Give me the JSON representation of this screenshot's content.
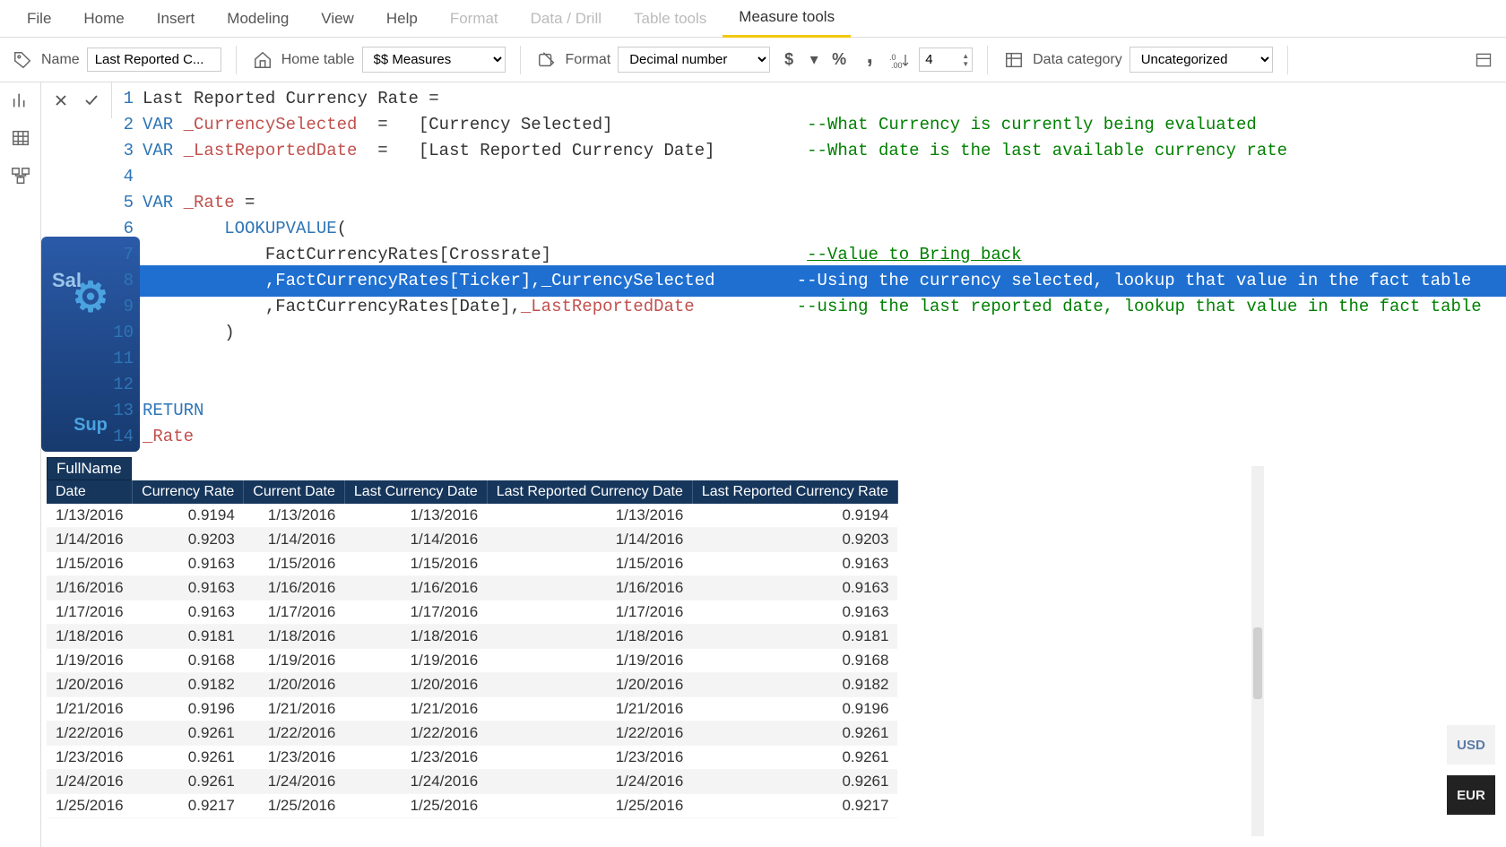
{
  "ribbon": {
    "tabs": [
      "File",
      "Home",
      "Insert",
      "Modeling",
      "View",
      "Help",
      "Format",
      "Data / Drill",
      "Table tools",
      "Measure tools"
    ],
    "active": "Measure tools",
    "dim": [
      "Format",
      "Data / Drill",
      "Table tools"
    ]
  },
  "toolbar": {
    "name_label": "Name",
    "name_value": "Last Reported C...",
    "home_table_label": "Home table",
    "home_table_value": "$$ Measures",
    "format_label": "Format",
    "format_value": "Decimal number",
    "decimals_value": "4",
    "data_category_label": "Data category",
    "data_category_value": "Uncategorized"
  },
  "formula": {
    "lines": [
      {
        "n": 1,
        "segs": [
          {
            "t": "Last Reported Currency Rate ",
            "c": "txt"
          },
          {
            "t": "=",
            "c": "txt"
          }
        ]
      },
      {
        "n": 2,
        "segs": [
          {
            "t": "VAR ",
            "c": "kw"
          },
          {
            "t": "_CurrencySelected",
            "c": "var"
          },
          {
            "t": "  =   ",
            "c": "txt"
          },
          {
            "t": "[Currency Selected]",
            "c": "txt"
          },
          {
            "t": "                   ",
            "c": "txt"
          },
          {
            "t": "--What Currency is currently being evaluated",
            "c": "cmt"
          }
        ]
      },
      {
        "n": 3,
        "segs": [
          {
            "t": "VAR ",
            "c": "kw"
          },
          {
            "t": "_LastReportedDate",
            "c": "var"
          },
          {
            "t": "  =   ",
            "c": "txt"
          },
          {
            "t": "[Last Reported Currency Date]",
            "c": "txt"
          },
          {
            "t": "         ",
            "c": "txt"
          },
          {
            "t": "--What date is the last available currency rate",
            "c": "cmt"
          }
        ]
      },
      {
        "n": 4,
        "segs": [
          {
            "t": "",
            "c": "txt"
          }
        ]
      },
      {
        "n": 5,
        "segs": [
          {
            "t": "VAR ",
            "c": "kw"
          },
          {
            "t": "_Rate",
            "c": "var"
          },
          {
            "t": " =",
            "c": "txt"
          }
        ]
      },
      {
        "n": 6,
        "segs": [
          {
            "t": "        ",
            "c": "txt"
          },
          {
            "t": "LOOKUPVALUE",
            "c": "fn"
          },
          {
            "t": "(",
            "c": "txt"
          }
        ]
      },
      {
        "n": 7,
        "segs": [
          {
            "t": "            FactCurrencyRates[Crossrate]",
            "c": "txt"
          },
          {
            "t": "                         ",
            "c": "txt"
          },
          {
            "t": "--Value to Bring back",
            "c": "cmt hl-under"
          }
        ]
      },
      {
        "n": 8,
        "hl": true,
        "segs": [
          {
            "t": "            ,FactCurrencyRates[Ticker],",
            "c": "txt"
          },
          {
            "t": "_CurrencySelected",
            "c": "var"
          },
          {
            "t": "        ",
            "c": "txt"
          },
          {
            "t": "--Using the currency selected, lookup that value in the fact table",
            "c": "cmt"
          }
        ]
      },
      {
        "n": 9,
        "segs": [
          {
            "t": "            ,FactCurrencyRates[Date],",
            "c": "txt"
          },
          {
            "t": "_LastReportedDate",
            "c": "var"
          },
          {
            "t": "          ",
            "c": "txt"
          },
          {
            "t": "--using the last reported date, lookup that value in the fact table",
            "c": "cmt"
          }
        ]
      },
      {
        "n": 10,
        "segs": [
          {
            "t": "        )",
            "c": "txt"
          }
        ]
      },
      {
        "n": 11,
        "segs": [
          {
            "t": "",
            "c": "txt"
          }
        ]
      },
      {
        "n": 12,
        "segs": [
          {
            "t": "",
            "c": "txt"
          }
        ]
      },
      {
        "n": 13,
        "segs": [
          {
            "t": "RETURN",
            "c": "kw"
          }
        ]
      },
      {
        "n": 14,
        "segs": [
          {
            "t": "_Rate",
            "c": "var"
          }
        ]
      }
    ]
  },
  "bgcard": {
    "t1": "Sal",
    "t2": "Sup"
  },
  "table": {
    "fullname": "FullName",
    "columns": [
      "Date",
      "Currency Rate",
      "Current Date",
      "Last Currency Date",
      "Last Reported Currency Date",
      "Last Reported Currency Rate"
    ],
    "rows": [
      [
        "1/13/2016",
        "0.9194",
        "1/13/2016",
        "1/13/2016",
        "1/13/2016",
        "0.9194"
      ],
      [
        "1/14/2016",
        "0.9203",
        "1/14/2016",
        "1/14/2016",
        "1/14/2016",
        "0.9203"
      ],
      [
        "1/15/2016",
        "0.9163",
        "1/15/2016",
        "1/15/2016",
        "1/15/2016",
        "0.9163"
      ],
      [
        "1/16/2016",
        "0.9163",
        "1/16/2016",
        "1/16/2016",
        "1/16/2016",
        "0.9163"
      ],
      [
        "1/17/2016",
        "0.9163",
        "1/17/2016",
        "1/17/2016",
        "1/17/2016",
        "0.9163"
      ],
      [
        "1/18/2016",
        "0.9181",
        "1/18/2016",
        "1/18/2016",
        "1/18/2016",
        "0.9181"
      ],
      [
        "1/19/2016",
        "0.9168",
        "1/19/2016",
        "1/19/2016",
        "1/19/2016",
        "0.9168"
      ],
      [
        "1/20/2016",
        "0.9182",
        "1/20/2016",
        "1/20/2016",
        "1/20/2016",
        "0.9182"
      ],
      [
        "1/21/2016",
        "0.9196",
        "1/21/2016",
        "1/21/2016",
        "1/21/2016",
        "0.9196"
      ],
      [
        "1/22/2016",
        "0.9261",
        "1/22/2016",
        "1/22/2016",
        "1/22/2016",
        "0.9261"
      ],
      [
        "1/23/2016",
        "0.9261",
        "1/23/2016",
        "1/23/2016",
        "1/23/2016",
        "0.9261"
      ],
      [
        "1/24/2016",
        "0.9261",
        "1/24/2016",
        "1/24/2016",
        "1/24/2016",
        "0.9261"
      ],
      [
        "1/25/2016",
        "0.9217",
        "1/25/2016",
        "1/25/2016",
        "1/25/2016",
        "0.9217"
      ]
    ]
  },
  "currency": {
    "usd": "USD",
    "eur": "EUR"
  }
}
